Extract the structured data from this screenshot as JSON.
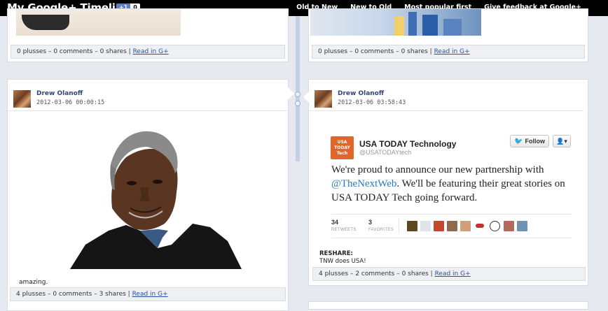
{
  "header": {
    "title": "My Google+ Timeline",
    "plus_badge": {
      "label": "+1",
      "count": "0"
    },
    "nav": [
      "Old to New",
      "New to Old",
      "Most popular first",
      "Give feedback at Google+"
    ]
  },
  "top_cards": {
    "left": {
      "stats": "0 plusses – 0 comments – 0 shares | ",
      "link": "Read in G+"
    },
    "right": {
      "stats": "0 plusses – 0 comments – 0 shares | ",
      "link": "Read in G+"
    }
  },
  "posts": {
    "left": {
      "author": "Drew Olanoff",
      "timestamp": "2012-03-06 00:00:15",
      "caption": "amazing.",
      "stats": "4 plusses – 0 comments – 3 shares | ",
      "link": "Read in G+"
    },
    "right": {
      "author": "Drew Olanoff",
      "timestamp": "2012-03-06 03:58:43",
      "tweet": {
        "logo_text": "USA TODAY Tech",
        "name": "USA TODAY Technology",
        "handle": "@USATODAYtech",
        "follow_label": "Follow",
        "menu_label": "▾",
        "text_before": "We're proud to announce our new partnership with ",
        "mention": "@TheNextWeb",
        "text_after": ". We'll be featuring their great stories on USA TODAY Tech going forward.",
        "retweets_count": "34",
        "retweets_label": "RETWEETS",
        "favorites_count": "3",
        "favorites_label": "FAVORITES"
      },
      "reshare_label": "RESHARE:",
      "reshare_text": "TNW does USA!",
      "stats": "4 plusses – 2 comments – 0 shares | ",
      "link": "Read in G+"
    }
  }
}
